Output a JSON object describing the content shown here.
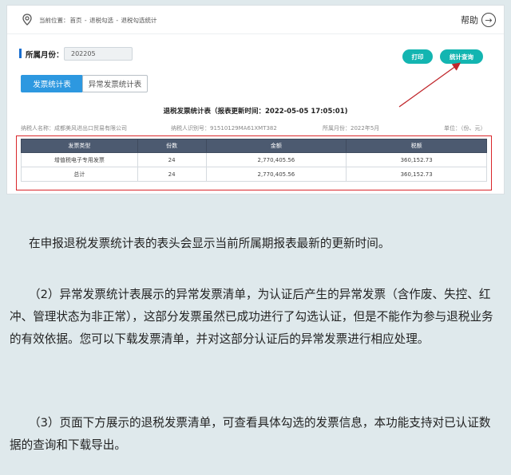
{
  "header": {
    "breadcrumb": [
      "当前位置：",
      "首页",
      " - ",
      "退税勾选",
      " - ",
      "退税勾选统计"
    ],
    "help_label": "帮助",
    "help_glyph": "→"
  },
  "filter": {
    "period_label": "所属月份：",
    "period_value": "202205"
  },
  "actions": {
    "print_label": "打印",
    "query_label": "统计查询"
  },
  "tabs": [
    {
      "label": "发票统计表",
      "active": true
    },
    {
      "label": "异常发票统计表",
      "active": false
    }
  ],
  "report": {
    "title": "退税发票统计表（报表更新时间：2022-05-05 17:05:01)",
    "taxpayer_name": "纳税人名称：成都美风进出口贸易有限公司",
    "taxpayer_id": "纳税人识别号：91510129MA61XMT382",
    "period": "所属月份：2022年5月",
    "unit": "单位：（份、元）"
  },
  "table": {
    "headers": [
      "发票类型",
      "份数",
      "金额",
      "税额"
    ],
    "rows": [
      [
        "增值税电子专用发票",
        "24",
        "2,770,405.56",
        "360,152.73"
      ],
      [
        "总计",
        "24",
        "2,770,405.56",
        "360,152.73"
      ]
    ]
  },
  "paragraphs": [
    "在申报退税发票统计表的表头会显示当前所属期报表最新的更新时间。",
    "（2）异常发票统计表展示的异常发票清单，为认证后产生的异常发票（含作废、失控、红冲、管理状态为非正常），这部分发票虽然已成功进行了勾选认证，但是不能作为参与退税业务的有效依据。您可以下载发票清单，并对这部分认证后的异常发票进行相应处理。",
    "（3）页面下方展示的退税发票清单，可查看具体勾选的发票信息，本功能支持对已认证数据的查询和下载导出。"
  ],
  "colors": {
    "accent_teal": "#13b5b1",
    "tab_blue": "#2d98e0",
    "table_header": "#4c5a70",
    "highlight_red": "#d9262a",
    "page_bg": "#dfe9ec"
  }
}
